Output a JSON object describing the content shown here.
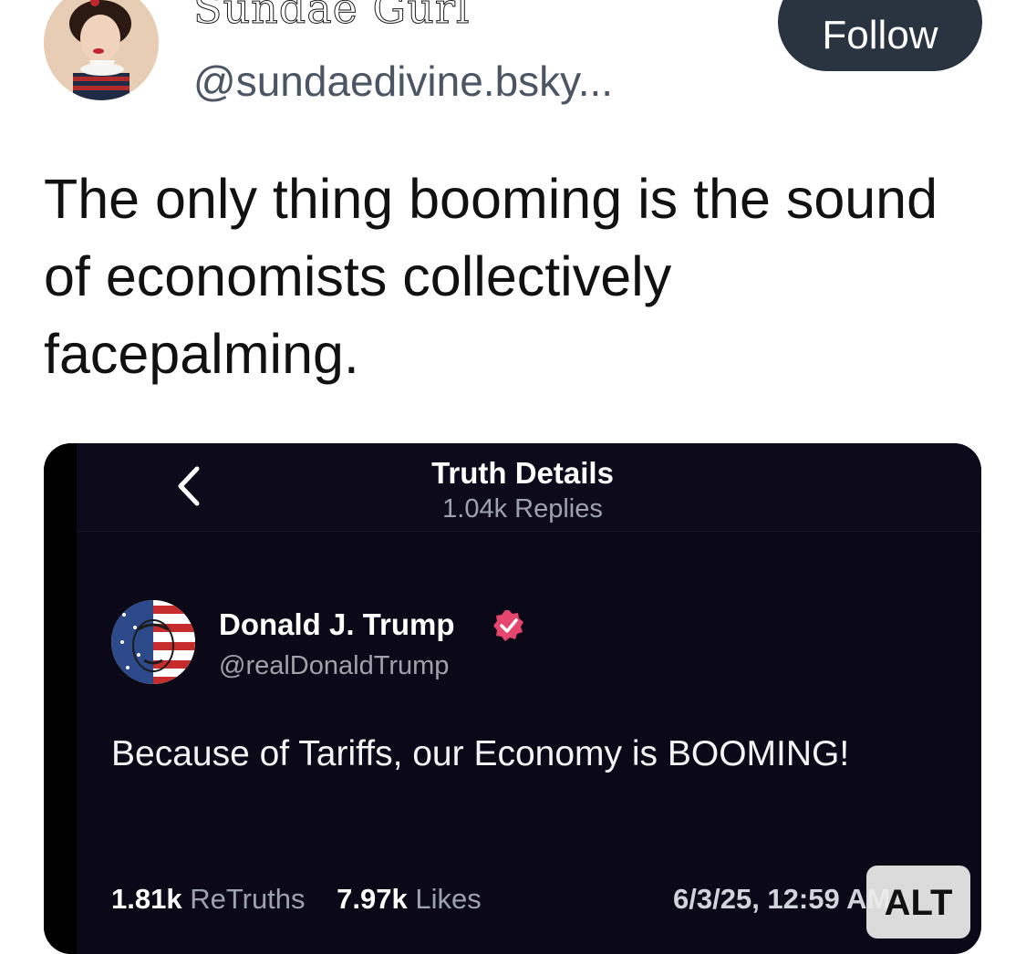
{
  "post": {
    "author_name": "Sundae Gurl",
    "author_handle": "@sundaedivine.bsky...",
    "follow_label": "Follow",
    "text": "The only thing booming is the sound of economists collectively facepalming."
  },
  "embed": {
    "title": "Truth Details",
    "subtitle": "1.04k Replies",
    "author_name": "Donald J. Trump",
    "author_handle": "@realDonaldTrump",
    "text": "Because of Tariffs, our Economy is BOOMING!",
    "retruths_count": "1.81k",
    "retruths_label": "ReTruths",
    "likes_count": "7.97k",
    "likes_label": "Likes",
    "timestamp": "6/3/25, 12:59 AM",
    "alt_label": "ALT"
  },
  "icons": {
    "back": "chevron-left-icon",
    "verified": "verified-badge-icon"
  },
  "colors": {
    "follow_bg": "#2a3441",
    "embed_bg": "#0b0818",
    "verified": "#e6466e"
  }
}
